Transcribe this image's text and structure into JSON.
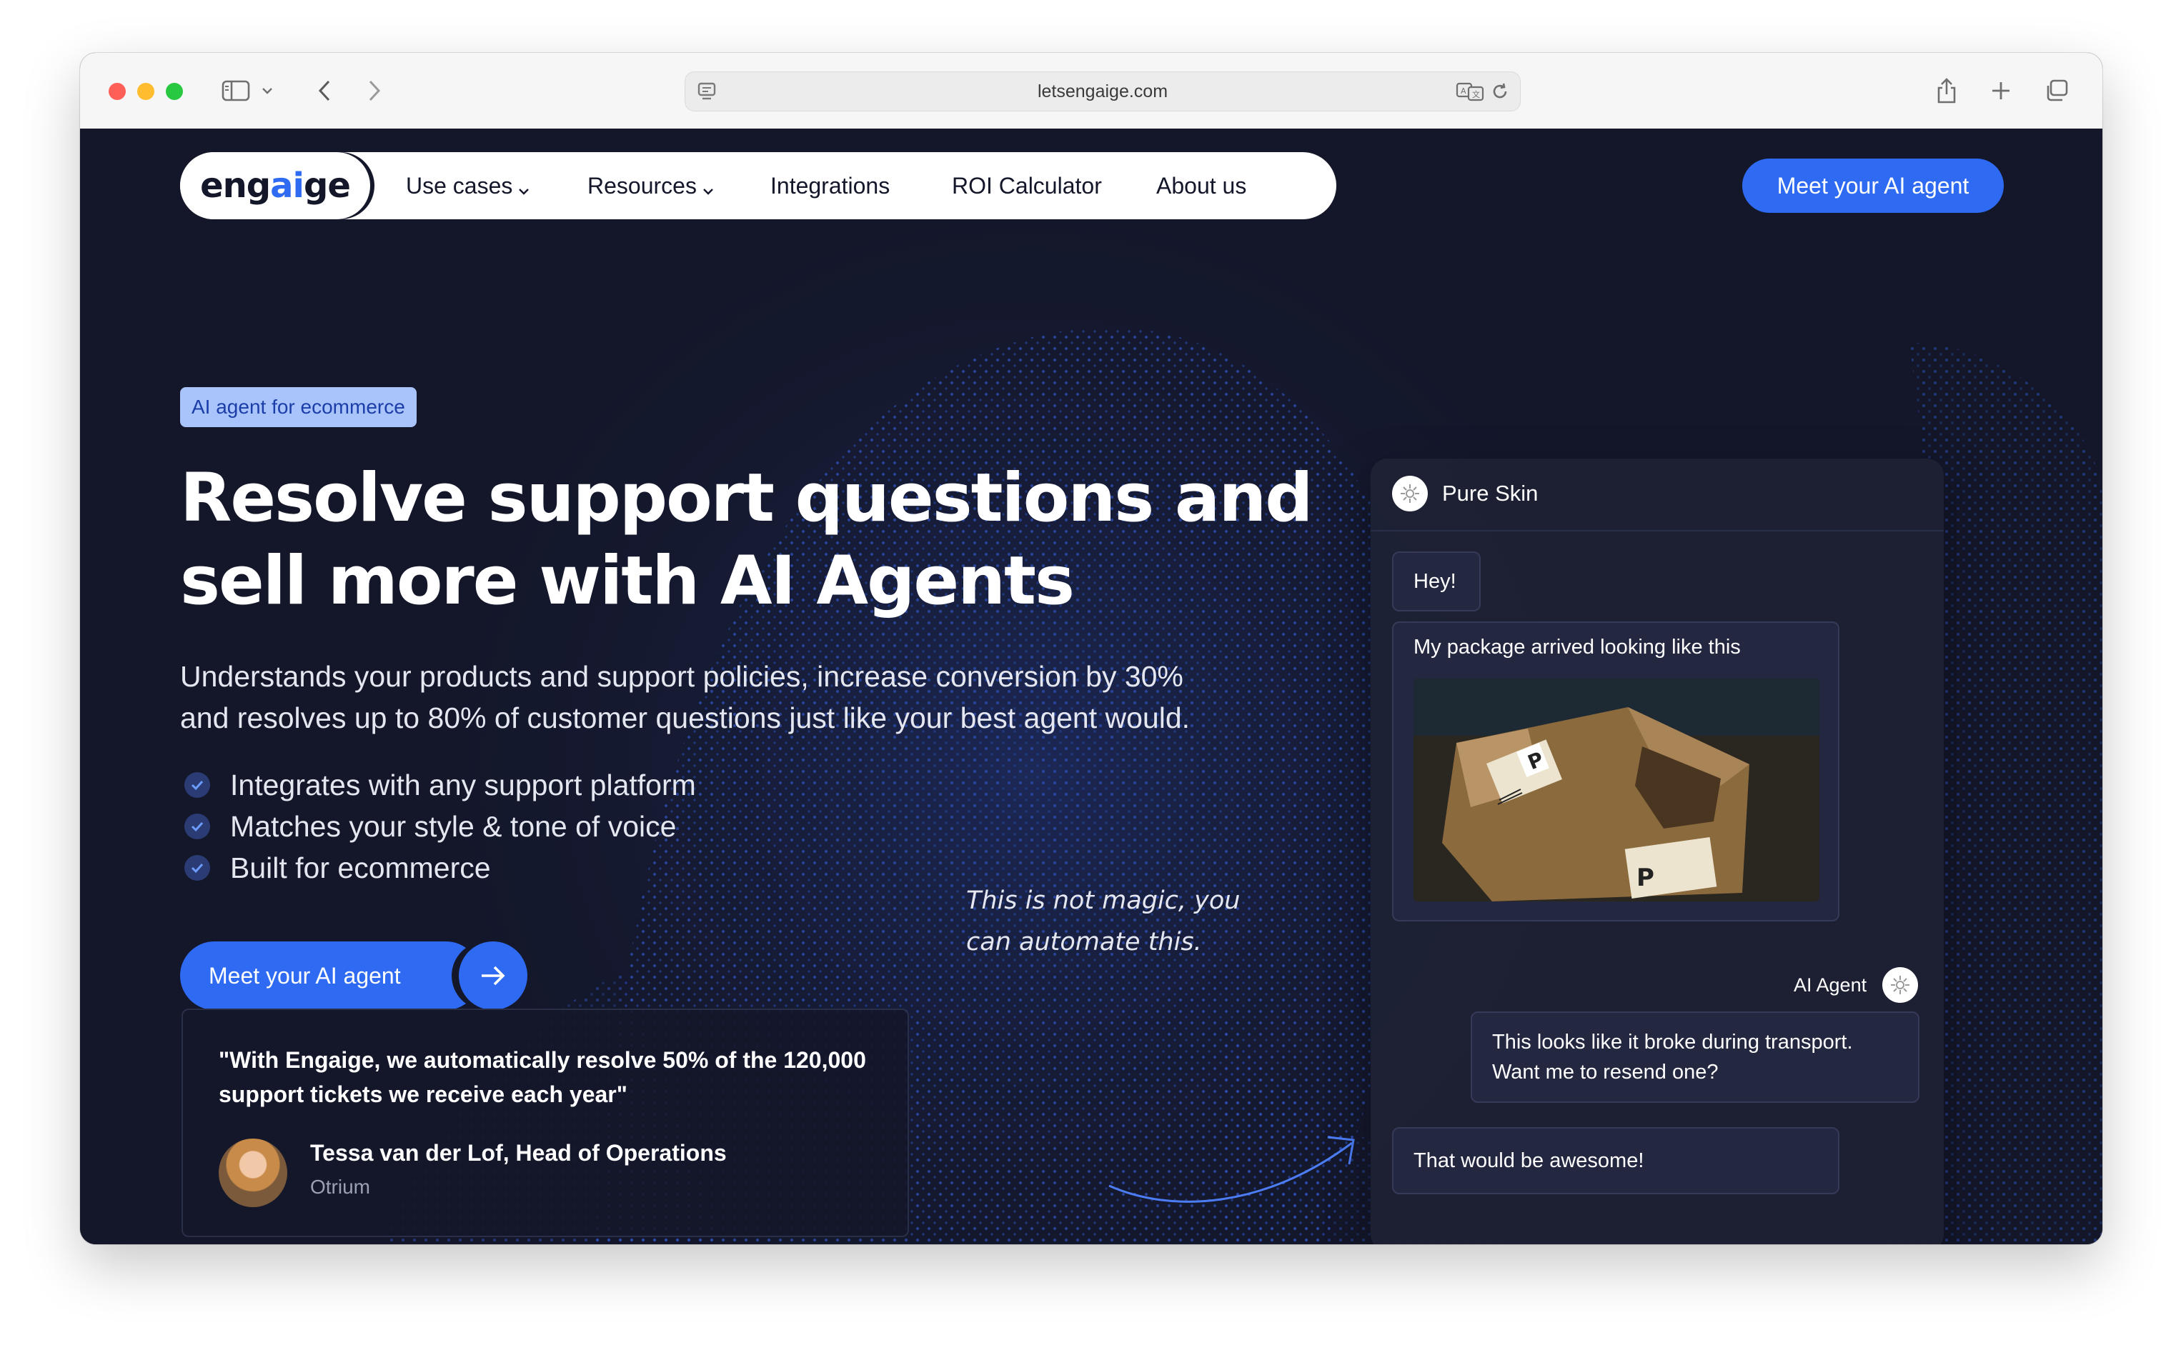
{
  "browser": {
    "url": "letsengaige.com"
  },
  "nav": {
    "logo_prefix": "eng",
    "logo_accent": "ai",
    "logo_suffix": "ge",
    "items": [
      {
        "label": "Use cases"
      },
      {
        "label": "Resources"
      },
      {
        "label": "Integrations"
      },
      {
        "label": "ROI Calculator"
      },
      {
        "label": "About us"
      }
    ],
    "cta": "Meet your AI agent"
  },
  "hero": {
    "tag": "AI agent for ecommerce",
    "headline_lines": [
      "Resolve support questions and",
      "sell more with AI Agents"
    ],
    "sub_lines": [
      "Understands your products and support policies, increase conversion by 30%",
      "and resolves up to 80% of customer questions just like your best agent would."
    ],
    "bullets": [
      "Integrates with any support platform",
      "Matches your style & tone of voice",
      "Built for ecommerce"
    ],
    "cta": "Meet your AI agent",
    "magic_lines": [
      "This is not magic, you",
      "can automate this."
    ]
  },
  "testimonial": {
    "quote_lines": [
      "\"With Engaige, we automatically resolve 50% of the 120,000",
      "support tickets we receive each year\""
    ],
    "author": "Tessa van der Lof, Head of Operations",
    "company": "Otrium"
  },
  "chat": {
    "store_name": "Pure Skin",
    "messages": [
      {
        "from": "customer",
        "text": "Hey!"
      },
      {
        "from": "customer",
        "text": "My package arrived looking like this"
      },
      {
        "from": "agent_label",
        "text": "AI Agent"
      },
      {
        "from": "agent",
        "lines": [
          "This looks like it broke during transport.",
          "Want me to resend one?"
        ]
      },
      {
        "from": "customer",
        "text": "That would be awesome!"
      }
    ]
  },
  "colors": {
    "brand_blue": "#2f6bf2",
    "page_bg": "#14172a",
    "tag_bg": "#a9c3fb"
  }
}
